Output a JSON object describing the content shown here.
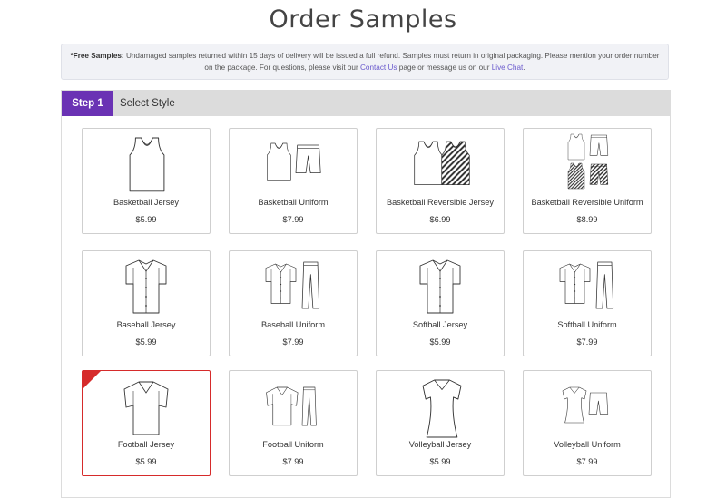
{
  "page": {
    "title": "Order Samples"
  },
  "notice": {
    "label": "*Free Samples:",
    "text1": " Undamaged samples returned within 15 days of delivery will be issued a full refund. Samples must return in original packaging. Please mention your order number on the package. For questions, please visit our ",
    "link_contact": "Contact Us",
    "text2": " page or message us on our ",
    "link_chat": "Live Chat",
    "text3": "."
  },
  "step": {
    "number": "Step 1",
    "label": "Select Style"
  },
  "products": [
    {
      "name": "Basketball Jersey",
      "price": "$5.99",
      "icon": "basketball-jersey-icon"
    },
    {
      "name": "Basketball Uniform",
      "price": "$7.99",
      "icon": "basketball-uniform-icon"
    },
    {
      "name": "Basketball Reversible Jersey",
      "price": "$6.99",
      "icon": "basketball-reversible-jersey-icon"
    },
    {
      "name": "Basketball Reversible Uniform",
      "price": "$8.99",
      "icon": "basketball-reversible-uniform-icon"
    },
    {
      "name": "Baseball Jersey",
      "price": "$5.99",
      "icon": "baseball-jersey-icon"
    },
    {
      "name": "Baseball Uniform",
      "price": "$7.99",
      "icon": "baseball-uniform-icon"
    },
    {
      "name": "Softball Jersey",
      "price": "$5.99",
      "icon": "softball-jersey-icon"
    },
    {
      "name": "Softball Uniform",
      "price": "$7.99",
      "icon": "softball-uniform-icon"
    },
    {
      "name": "Football Jersey",
      "price": "$5.99",
      "icon": "football-jersey-icon",
      "selected": true
    },
    {
      "name": "Football Uniform",
      "price": "$7.99",
      "icon": "football-uniform-icon"
    },
    {
      "name": "Volleyball Jersey",
      "price": "$5.99",
      "icon": "volleyball-jersey-icon"
    },
    {
      "name": "Volleyball Uniform",
      "price": "$7.99",
      "icon": "volleyball-uniform-icon"
    }
  ],
  "colors": {
    "accent": "#6a32b4",
    "selected": "#d62b2b",
    "link": "#6a5acd"
  }
}
